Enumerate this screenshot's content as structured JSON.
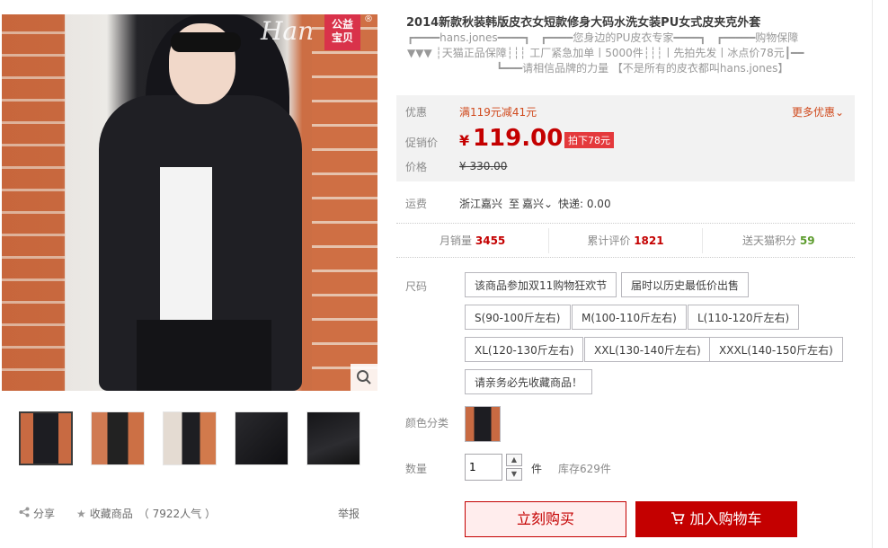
{
  "gallery": {
    "badge_line1": "公益",
    "badge_line2": "宝贝",
    "watermark": "Han",
    "reg_mark": "®",
    "zoom_icon": "magnifier-icon",
    "thumbnails": [
      "thumb-1",
      "thumb-2",
      "thumb-3",
      "thumb-4",
      "thumb-5"
    ]
  },
  "actions": {
    "share_label": "分享",
    "fav_label": "收藏商品",
    "fav_count": "（ 7922人气 ）",
    "report_label": "举报"
  },
  "product": {
    "title": "2014新款秋装韩版皮衣女短款修身大码水洗女装PU女式皮夹克外套",
    "subtitle_line1": "┏━━━━hans.jones━━━━┓   ┏━━━━您身边的PU皮衣专家━━━━┓   ┏━━━━━购物保障",
    "subtitle_line2": "▼▼▼ ┆天猫正品保障┆┆┆ 工厂紧急加单丨5000件┆┆┆丨先拍先发丨冰点价78元┃━━",
    "subtitle_line3": "                          ┗━━━请相信品牌的力量 【不是所有的皮衣都叫hans.jones】"
  },
  "price": {
    "promo_label": "优惠",
    "promo_value": "满119元减41元",
    "more_label": "更多优惠",
    "sale_label": "促销价",
    "currency": "¥",
    "sale_price": "119.00",
    "tag": "拍下78元",
    "orig_label": "价格",
    "orig_price": "¥ 330.00"
  },
  "shipping": {
    "label": "运费",
    "from": "浙江嘉兴",
    "to_word": "至",
    "to": "嘉兴",
    "method": "快递: 0.00"
  },
  "stats": {
    "monthly_label": "月销量",
    "monthly_value": "3455",
    "reviews_label": "累计评价",
    "reviews_value": "1821",
    "points_label": "送天猫积分",
    "points_value": "59"
  },
  "size": {
    "label": "尺码",
    "options": [
      "该商品参加双11购物狂欢节",
      "届时以历史最低价出售",
      "S(90-100斤左右)",
      "M(100-110斤左右)",
      "L(110-120斤左右)",
      "XL(120-130斤左右)",
      "XXL(130-140斤左右)",
      "XXXL(140-150斤左右)",
      "请亲务必先收藏商品！"
    ]
  },
  "color": {
    "label": "颜色分类"
  },
  "quantity": {
    "label": "数量",
    "value": "1",
    "unit": "件",
    "stock": "库存629件"
  },
  "buttons": {
    "buy_now": "立刻购买",
    "add_cart": "加入购物车"
  },
  "colors": {
    "accent": "#c40000",
    "badge": "#d9324a",
    "price_bg": "#f2f2f2"
  }
}
